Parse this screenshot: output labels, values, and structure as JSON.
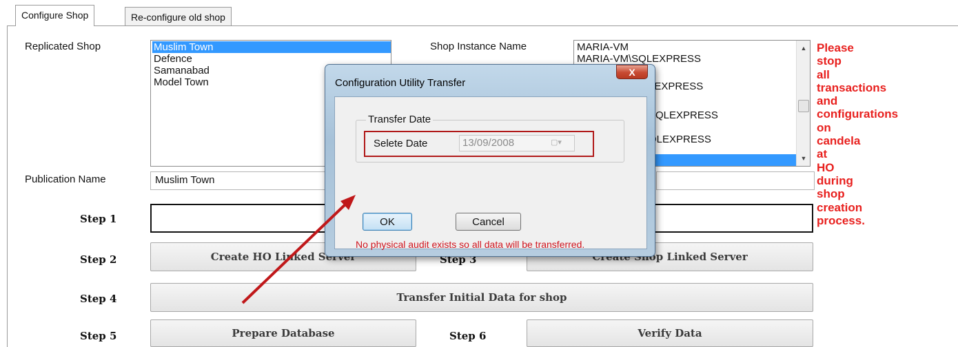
{
  "tabs": [
    {
      "label": "Configure Shop",
      "active": true
    },
    {
      "label": "Re-configure old shop",
      "active": false
    }
  ],
  "replicated_shop": {
    "label": "Replicated Shop",
    "items": [
      "Muslim Town",
      "Defence",
      "Samanabad",
      "Model Town"
    ],
    "selected": "Muslim Town"
  },
  "instance": {
    "label": "Shop Instance Name",
    "items": [
      "MARIA-VM",
      "MARIA-VM\\SQLEXPRESS",
      "LEXPRESS",
      "SQLEXPRESS",
      "QLEXPRESS"
    ]
  },
  "publication": {
    "label": "Publication Name",
    "value": "Muslim Town"
  },
  "steps": {
    "step1": "Step 1",
    "step2": "Step 2",
    "step3": "Step 3",
    "step4": "Step 4",
    "step5": "Step 5",
    "step6": "Step 6"
  },
  "buttons": {
    "create_ho": "Create HO Linked Server",
    "create_shop": "Create Shop Linked Server",
    "transfer": "Transfer Initial Data for shop",
    "prepare": "Prepare Database",
    "verify": "Verify Data"
  },
  "warning": "Please\nstop\nall\ntransactions\nand\nconfigurations\non\ncandela\nat\nHO\nduring\nshop\ncreation\nprocess.",
  "dialog": {
    "title": "Configuration Utility Transfer",
    "close": "X",
    "group_title": "Transfer Date",
    "date_label": "Selete Date",
    "date_value": "13/09/2008",
    "ok": "OK",
    "cancel": "Cancel",
    "message": "No physical audit exists so all data will be transferred."
  },
  "colors": {
    "warning_red": "#e8201e",
    "highlight_box": "#b01818",
    "selection_blue": "#3399ff",
    "arrow": "#c0181a"
  }
}
